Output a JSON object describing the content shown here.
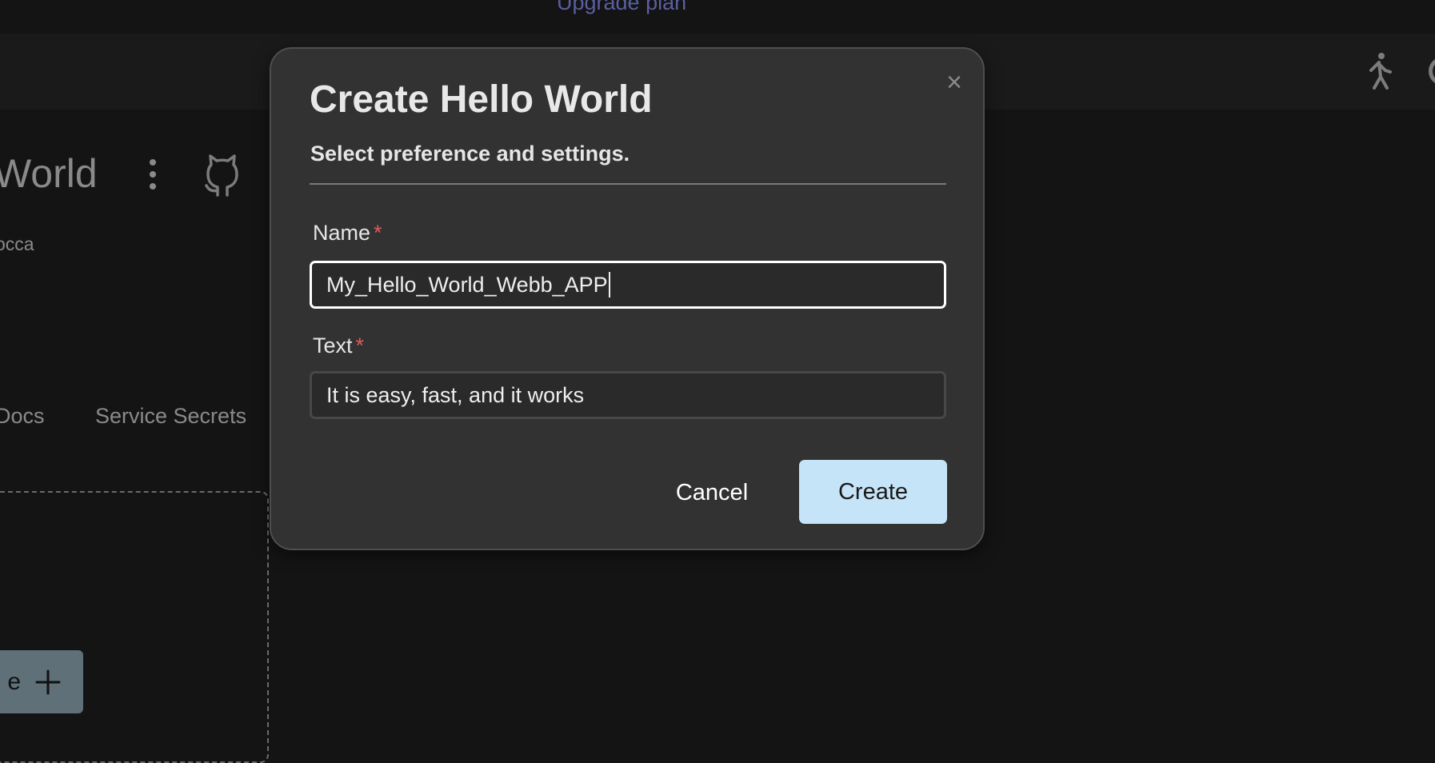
{
  "topbar": {
    "upgrade_label": "Upgrade plan"
  },
  "header": {
    "walk_icon": "walking-person-icon",
    "profile_icon": "circle-icon"
  },
  "project": {
    "title": "World",
    "owner": "occa",
    "menu_icon": "kebab-icon",
    "repo_icon": "github-icon"
  },
  "tabs": [
    {
      "label": "Docs"
    },
    {
      "label": "Service Secrets"
    }
  ],
  "add_button": {
    "label": "e",
    "icon": "plus-icon"
  },
  "modal": {
    "title": "Create Hello World",
    "subtitle": "Select preference and settings.",
    "required_marker": "*",
    "fields": [
      {
        "label": "Name",
        "value": "My_Hello_World_Webb_APP"
      },
      {
        "label": "Text",
        "value": "It is easy, fast, and it works"
      }
    ],
    "cancel_label": "Cancel",
    "create_label": "Create",
    "close_icon": "close-icon"
  },
  "colors": {
    "accent": "#c6e4f8",
    "required": "#e05a5a",
    "link": "#5a5fa0"
  }
}
